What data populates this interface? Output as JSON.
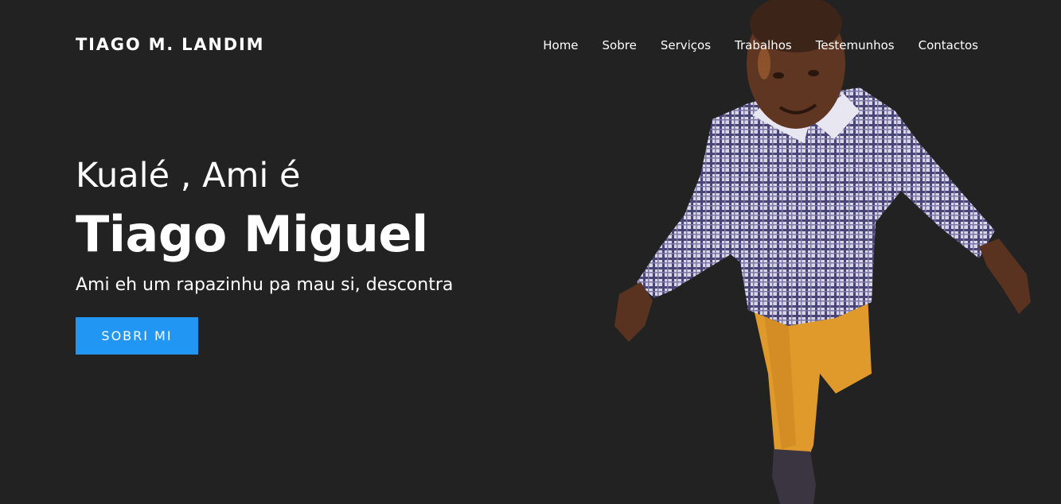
{
  "header": {
    "logo": "TIAGO M. LANDIM",
    "nav": [
      {
        "label": "Home"
      },
      {
        "label": "Sobre"
      },
      {
        "label": "Serviços"
      },
      {
        "label": "Trabalhos"
      },
      {
        "label": "Testemunhos"
      },
      {
        "label": "Contactos"
      }
    ]
  },
  "hero": {
    "greeting": "Kualé , Ami é",
    "name": "Tiago Miguel",
    "tagline": "Ami eh um rapazinhu pa mau si, descontra",
    "cta_label": "SOBRI MI"
  },
  "colors": {
    "background": "#222222",
    "text": "#ffffff",
    "accent": "#2196f3"
  }
}
